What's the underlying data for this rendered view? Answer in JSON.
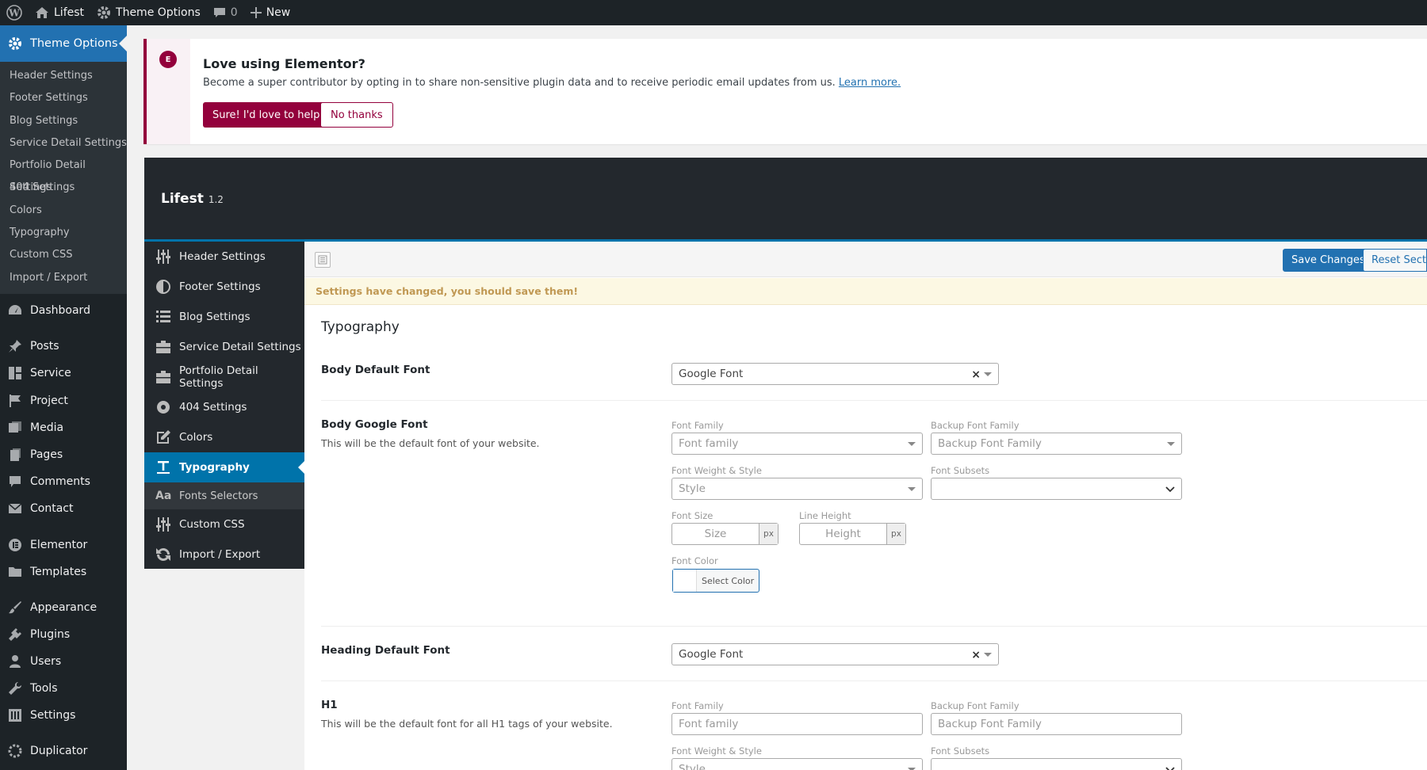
{
  "adminbar": {
    "site": "Lifest",
    "theme_options": "Theme Options",
    "comments_count": "0",
    "new": "New"
  },
  "sidebar": {
    "current": "Theme Options",
    "submenu": [
      "Header Settings",
      "Footer Settings",
      "Blog Settings",
      "Service Detail Settings",
      "Portfolio Detail Settings",
      "404 Settings",
      "Colors",
      "Typography",
      "Custom CSS",
      "Import / Export"
    ],
    "menu": [
      "Dashboard",
      "Posts",
      "Service",
      "Project",
      "Media",
      "Pages",
      "Comments",
      "Contact",
      "Elementor",
      "Templates",
      "Appearance",
      "Plugins",
      "Users",
      "Tools",
      "Settings",
      "Duplicator"
    ]
  },
  "notice": {
    "icon": "E",
    "title": "Love using Elementor?",
    "text": "Become a super contributor by opting in to share non-sensitive plugin data and to receive periodic email updates from us.",
    "link": "Learn more.",
    "btn_yes": "Sure! I'd love to help",
    "btn_no": "No thanks"
  },
  "header": {
    "title": "Lifest",
    "version": "1.2"
  },
  "redux_nav": {
    "items": [
      "Header Settings",
      "Footer Settings",
      "Blog Settings",
      "Service Detail Settings",
      "Portfolio Detail Settings",
      "404 Settings",
      "Colors",
      "Typography"
    ],
    "active": "Typography",
    "sub": "Fonts Selectors",
    "sub_icon": "Aa",
    "after": [
      "Custom CSS",
      "Import / Export"
    ]
  },
  "toolbar": {
    "save": "Save Changes",
    "reset": "Reset Section"
  },
  "warning": "Settings have changed, you should save them!",
  "section_title": "Typography",
  "body_default_font": {
    "label": "Body Default Font",
    "value": "Google Font"
  },
  "body_google_font": {
    "label": "Body Google Font",
    "desc": "This will be the default font of your website.",
    "font_family_label": "Font Family",
    "font_family_ph": "Font family",
    "backup_label": "Backup Font Family",
    "backup_ph": "Backup Font Family",
    "weight_label": "Font Weight & Style",
    "weight_ph": "Style",
    "subsets_label": "Font Subsets",
    "size_label": "Font Size",
    "size_ph": "Size",
    "lh_label": "Line Height",
    "lh_ph": "Height",
    "unit": "px",
    "color_label": "Font Color",
    "color_btn": "Select Color"
  },
  "heading_default_font": {
    "label": "Heading Default Font",
    "value": "Google Font"
  },
  "h1": {
    "label": "H1",
    "desc": "This will be the default font for all H1 tags of your website.",
    "font_family_label": "Font Family",
    "font_family_ph": "Font family",
    "backup_label": "Backup Font Family",
    "backup_ph": "Backup Font Family",
    "weight_label": "Font Weight & Style",
    "weight_ph": "Style",
    "subsets_label": "Font Subsets"
  }
}
